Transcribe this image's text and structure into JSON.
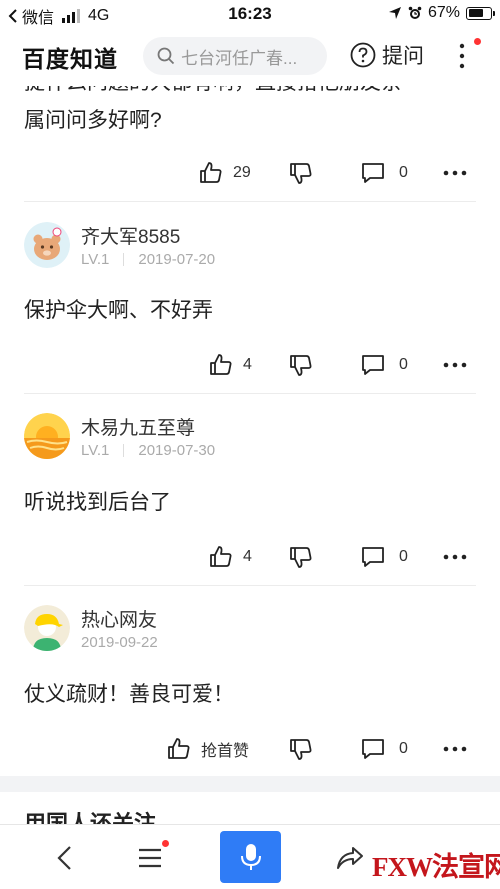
{
  "status_bar": {
    "app": "微信",
    "network": "4G",
    "time": "16:23",
    "battery": "67%",
    "battery_level": 0.67
  },
  "header": {
    "logo": "百度知道",
    "search_placeholder": "七台河任广春...",
    "ask_label": "提问"
  },
  "question_tail": {
    "text_line1": "捉什么问题的大都有啊，直接拾他朋友亲",
    "text_line2": "属问问多好啊?",
    "likes": "29",
    "comments": "0"
  },
  "answers": [
    {
      "name": "齐大军8585",
      "level": "LV.1",
      "date": "2019-07-20",
      "text": "保护伞大啊、不好弄",
      "likes": "4",
      "comments": "0"
    },
    {
      "name": "木易九五至尊",
      "level": "LV.1",
      "date": "2019-07-30",
      "text": "听说找到后台了",
      "likes": "4",
      "comments": "0"
    },
    {
      "name": "热心网友",
      "date": "2019-09-22",
      "text": "仗义疏财！善良可爱！",
      "likes": "抢首赞",
      "comments": "0"
    }
  ],
  "next_section_title": "用国人还关注",
  "watermark": "FXW法宣网",
  "colors": {
    "accent_blue": "#2f7cf6",
    "notification_red": "#ff3333",
    "watermark_red": "#c4161c"
  },
  "icons": [
    "location-icon",
    "alarm-icon",
    "battery-icon",
    "search-icon",
    "question-circle-icon",
    "more-vertical-icon",
    "thumbs-up-icon",
    "thumbs-down-icon",
    "comment-icon",
    "more-horizontal-icon",
    "back-icon",
    "menu-icon",
    "mic-icon",
    "share-icon"
  ]
}
